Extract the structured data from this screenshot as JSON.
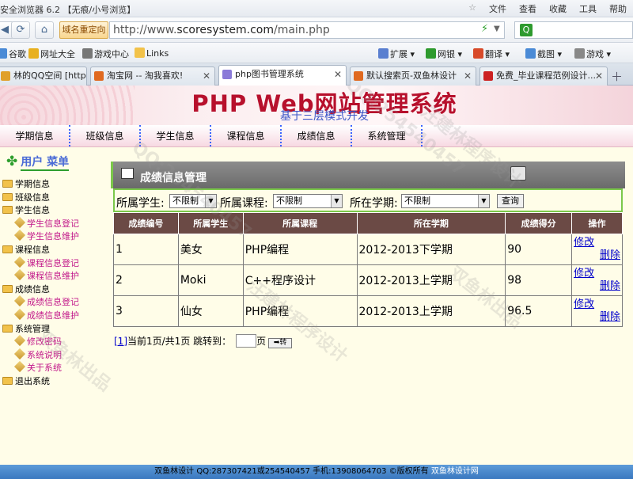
{
  "browser": {
    "window_title": "安全浏览器 6.2 【无痕/小号浏览】",
    "menu": [
      "文件",
      "查看",
      "收藏",
      "工具",
      "帮助"
    ],
    "redirect_label": "域名重定向",
    "url_prefix": "http://www.",
    "url_host": "scoresystem.com",
    "url_path": "/main.php",
    "favorites": [
      "谷歌",
      "网址大全",
      "游戏中心",
      "Links"
    ],
    "tools": [
      "扩展",
      "网银",
      "翻译",
      "截图",
      "游戏"
    ],
    "tabs": [
      {
        "label": "林的QQ空间 [http:",
        "icon_color": "#e0a02a"
      },
      {
        "label": "淘宝网 -- 淘我喜欢!",
        "icon_color": "#e06a20"
      },
      {
        "label": "php图书管理系统",
        "icon_color": "#8a7ad8"
      },
      {
        "label": "默认搜索页-双鱼林设计",
        "icon_color": "#e06a20"
      },
      {
        "label": "免费_毕业课程范例设计...",
        "icon_color": "#cc2222"
      }
    ]
  },
  "site": {
    "title": "PHP Web网站管理系统",
    "subtitle": "基于三层模式开发"
  },
  "topnav": [
    "学期信息",
    "班级信息",
    "学生信息",
    "课程信息",
    "成绩信息",
    "系统管理"
  ],
  "sidebar": {
    "heading": "用户 菜单",
    "items": [
      {
        "label": "学期信息",
        "level": "top"
      },
      {
        "label": "班级信息",
        "level": "top"
      },
      {
        "label": "学生信息",
        "level": "top"
      },
      {
        "label": "学生信息登记",
        "level": "sub"
      },
      {
        "label": "学生信息维护",
        "level": "sub"
      },
      {
        "label": "课程信息",
        "level": "top"
      },
      {
        "label": "课程信息登记",
        "level": "sub"
      },
      {
        "label": "课程信息维护",
        "level": "sub"
      },
      {
        "label": "成绩信息",
        "level": "top"
      },
      {
        "label": "成绩信息登记",
        "level": "sub"
      },
      {
        "label": "成绩信息维护",
        "level": "sub"
      },
      {
        "label": "系统管理",
        "level": "top"
      },
      {
        "label": "修改密码",
        "level": "sub"
      },
      {
        "label": "系统说明",
        "level": "sub"
      },
      {
        "label": "关于系统",
        "level": "sub"
      },
      {
        "label": "退出系统",
        "level": "top"
      }
    ]
  },
  "panel": {
    "title": "成绩信息管理",
    "filters": {
      "student_label": "所属学生:",
      "student_value": "不限制",
      "course_label": "所属课程:",
      "course_value": "不限制",
      "term_label": "所在学期:",
      "term_value": "不限制",
      "query_label": "查询"
    },
    "table": {
      "headers": [
        "成绩编号",
        "所属学生",
        "所属课程",
        "所在学期",
        "成绩得分",
        "操作"
      ],
      "rows": [
        [
          "1",
          "美女",
          "PHP编程",
          "2012-2013下学期",
          "90"
        ],
        [
          "2",
          "Moki",
          "C++程序设计",
          "2012-2013上学期",
          "98"
        ],
        [
          "3",
          "仙女",
          "PHP编程",
          "2012-2013上学期",
          "96.5"
        ]
      ],
      "edit_label": "修改",
      "delete_label": "删除"
    },
    "pager": {
      "page_link": "[1]",
      "status": "当前1页/共1页 跳转到：",
      "page_unit": "页",
      "go_label": "➡转"
    }
  },
  "footer": {
    "text": "双鱼林设计 QQ:287307421或254540457 手机:13908064703 ©版权所有 ",
    "link": "双鱼林设计网"
  },
  "watermarks": [
    "QQ:254540457",
    "汪建林程序设计",
    "双鱼林出品"
  ]
}
